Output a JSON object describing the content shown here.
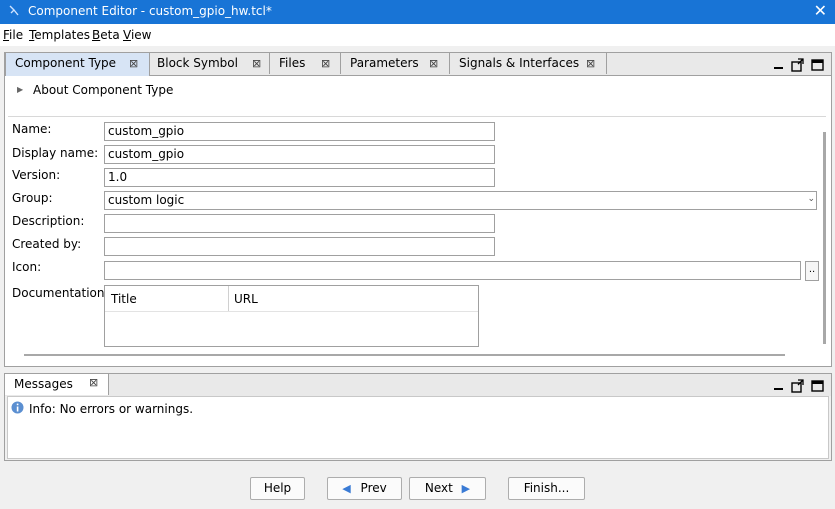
{
  "window": {
    "title": "Component Editor - custom_gpio_hw.tcl*"
  },
  "menu": [
    "File",
    "Templates",
    "Beta",
    "View"
  ],
  "editor": {
    "tabs": [
      "Component Type",
      "Block Symbol",
      "Files",
      "Parameters",
      "Signals & Interfaces"
    ],
    "about_label": "About Component Type",
    "fields": {
      "name": {
        "label": "Name:",
        "value": "custom_gpio"
      },
      "display_name": {
        "label": "Display name:",
        "value": "custom_gpio"
      },
      "version": {
        "label": "Version:",
        "value": "1.0"
      },
      "group": {
        "label": "Group:",
        "value": "custom logic"
      },
      "description": {
        "label": "Description:",
        "value": ""
      },
      "created_by": {
        "label": "Created by:",
        "value": ""
      },
      "icon": {
        "label": "Icon:",
        "value": "",
        "browse_label": ".."
      },
      "documentation": {
        "label": "Documentation:",
        "columns": [
          "Title",
          "URL"
        ]
      }
    }
  },
  "messages": {
    "tab": "Messages",
    "items": [
      {
        "icon": "info-icon",
        "text": "Info: No errors or warnings."
      }
    ]
  },
  "footer": {
    "help": "Help",
    "prev": "Prev",
    "next": "Next",
    "finish": "Finish..."
  }
}
